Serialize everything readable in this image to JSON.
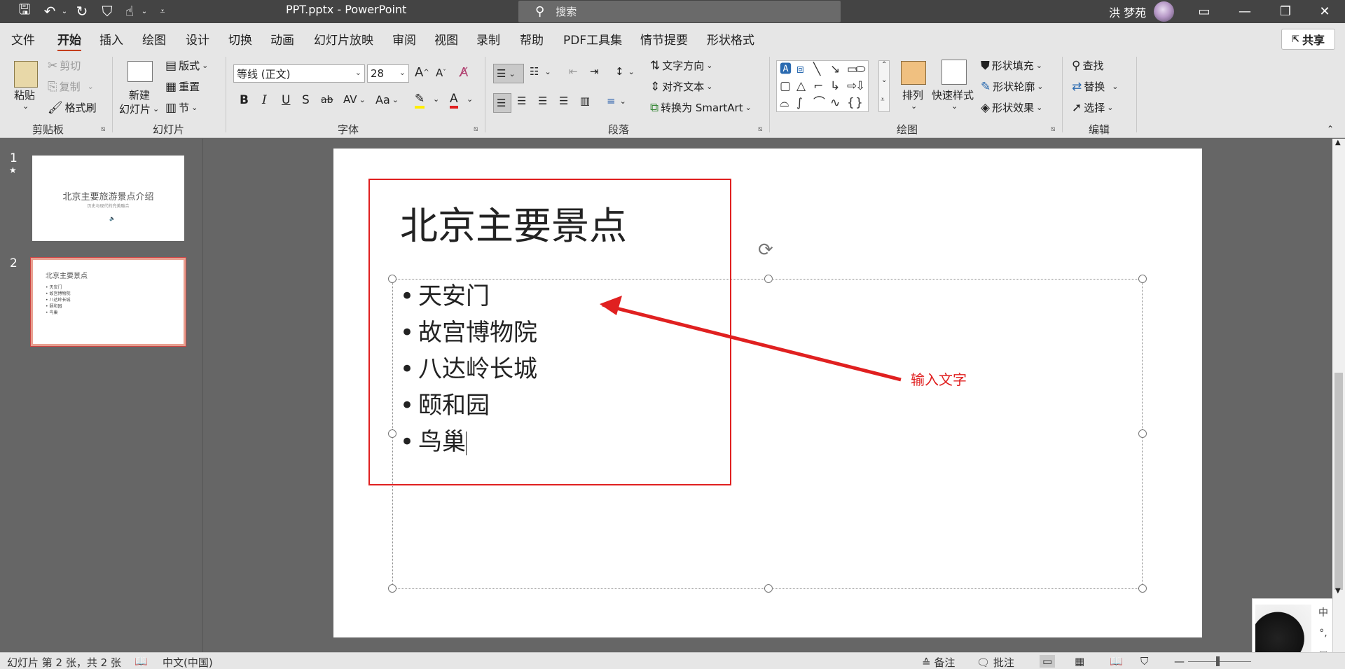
{
  "window": {
    "title": "PPT.pptx  -  PowerPoint",
    "search_placeholder": "搜索",
    "user": "洪 梦苑",
    "share": "共享"
  },
  "tabs": [
    "文件",
    "开始",
    "插入",
    "绘图",
    "设计",
    "切换",
    "动画",
    "幻灯片放映",
    "审阅",
    "视图",
    "录制",
    "帮助",
    "PDF工具集",
    "情节提要",
    "形状格式"
  ],
  "ribbon": {
    "clipboard": {
      "label": "剪贴板",
      "paste": "粘贴",
      "cut": "剪切",
      "copy": "复制",
      "format_painter": "格式刷"
    },
    "slides": {
      "label": "幻灯片",
      "new_slide_1": "新建",
      "new_slide_2": "幻灯片",
      "layout": "版式",
      "reset": "重置",
      "section": "节"
    },
    "font": {
      "label": "字体",
      "font_name": "等线 (正文)",
      "font_size": "28"
    },
    "paragraph": {
      "label": "段落",
      "text_direction": "文字方向",
      "align_text": "对齐文本",
      "smartart": "转换为 SmartArt"
    },
    "drawing": {
      "label": "绘图",
      "arrange": "排列",
      "quick_styles": "快速样式",
      "shape_fill": "形状填充",
      "shape_outline": "形状轮廓",
      "shape_effects": "形状效果"
    },
    "editing": {
      "label": "编辑",
      "find": "查找",
      "replace": "替换",
      "select": "选择"
    }
  },
  "thumbnails": [
    {
      "num": "1",
      "title": "北京主要旅游景点介绍",
      "subtitle": "历史与现代的完美融合"
    },
    {
      "num": "2",
      "title": "北京主要景点",
      "items": [
        "• 天安门",
        "• 故宫博物院",
        "• 八达岭长城",
        "• 颐和园",
        "• 鸟巢"
      ]
    }
  ],
  "slide": {
    "title": "北京主要景点",
    "bullets": [
      "天安门",
      "故宫博物院",
      "八达岭长城",
      "颐和园",
      "鸟巢"
    ],
    "annotation": "输入文字"
  },
  "status": {
    "slide_info": "幻灯片 第 2 张，共 2 张",
    "language": "中文(中国)",
    "notes": "备注",
    "comments": "批注"
  },
  "ime": {
    "mode": "中"
  },
  "colors": {
    "accent": "#c43e1c",
    "annotation_red": "#e02020",
    "titlebar": "#444444"
  }
}
